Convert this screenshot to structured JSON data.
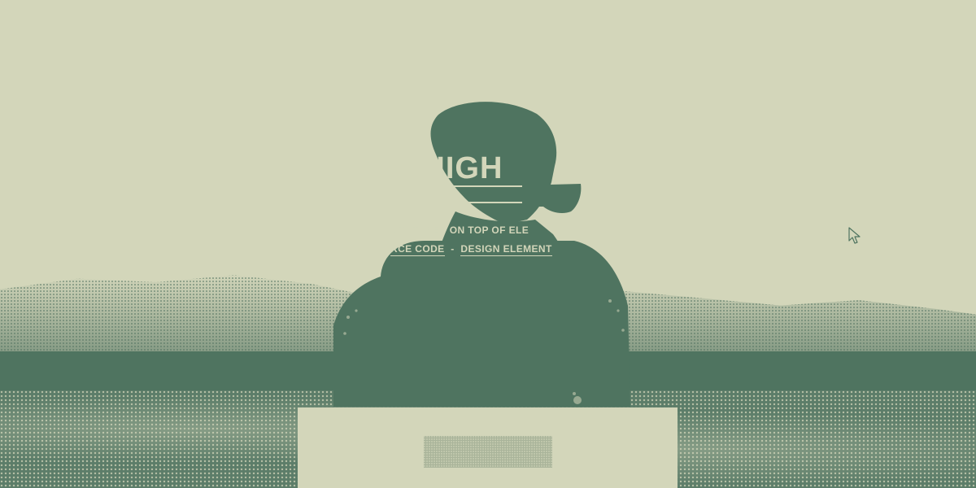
{
  "hero": {
    "title": "TY HIGH",
    "subtitle_line1": "OTOTYPED ON TOP OF ELE",
    "link_source": "RCE CODE",
    "separator": "-",
    "link_design": "DESIGN ELEMENT"
  },
  "card": {
    "button_label": ""
  },
  "colors": {
    "background": "#d3d6ba",
    "accent_dark": "#4f7460",
    "button_fill": "#a9b49a"
  },
  "icons": {
    "cursor": "arrow-cursor-icon"
  }
}
